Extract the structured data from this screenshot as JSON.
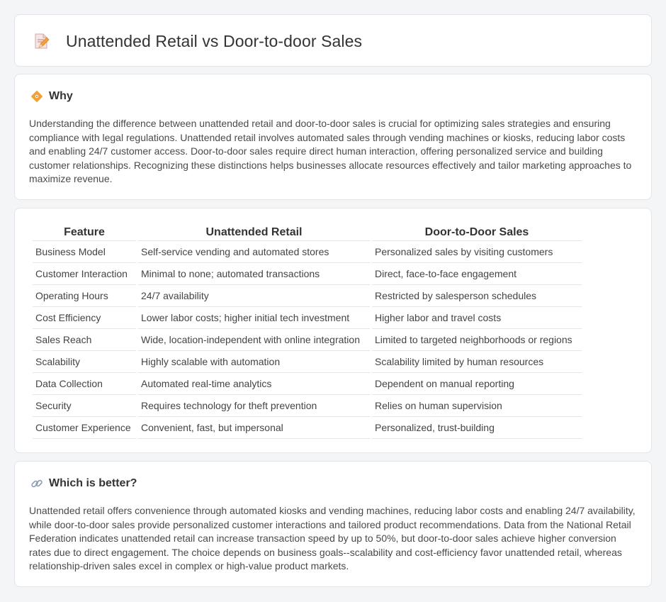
{
  "header": {
    "title": "Unattended Retail vs Door-to-door Sales",
    "icon": "document-edit-icon"
  },
  "why": {
    "title": "Why",
    "icon": "diamond-signal-icon",
    "body": "Understanding the difference between unattended retail and door-to-door sales is crucial for optimizing sales strategies and ensuring compliance with legal regulations. Unattended retail involves automated sales through vending machines or kiosks, reducing labor costs and enabling 24/7 customer access. Door-to-door sales require direct human interaction, offering personalized service and building customer relationships. Recognizing these distinctions helps businesses allocate resources effectively and tailor marketing approaches to maximize revenue."
  },
  "table": {
    "headers": [
      "Feature",
      "Unattended Retail",
      "Door-to-Door Sales"
    ],
    "rows": [
      [
        "Business Model",
        "Self-service vending and automated stores",
        "Personalized sales by visiting customers"
      ],
      [
        "Customer Interaction",
        "Minimal to none; automated transactions",
        "Direct, face-to-face engagement"
      ],
      [
        "Operating Hours",
        "24/7 availability",
        "Restricted by salesperson schedules"
      ],
      [
        "Cost Efficiency",
        "Lower labor costs; higher initial tech investment",
        "Higher labor and travel costs"
      ],
      [
        "Sales Reach",
        "Wide, location-independent with online integration",
        "Limited to targeted neighborhoods or regions"
      ],
      [
        "Scalability",
        "Highly scalable with automation",
        "Scalability limited by human resources"
      ],
      [
        "Data Collection",
        "Automated real-time analytics",
        "Dependent on manual reporting"
      ],
      [
        "Security",
        "Requires technology for theft prevention",
        "Relies on human supervision"
      ],
      [
        "Customer Experience",
        "Convenient, fast, but impersonal",
        "Personalized, trust-building"
      ]
    ]
  },
  "better": {
    "title": "Which is better?",
    "icon": "link-icon",
    "body": "Unattended retail offers convenience through automated kiosks and vending machines, reducing labor costs and enabling 24/7 availability, while door-to-door sales provide personalized customer interactions and tailored product recommendations. Data from the National Retail Federation indicates unattended retail can increase transaction speed by up to 50%, but door-to-door sales achieve higher conversion rates due to direct engagement. The choice depends on business goals--scalability and cost-efficiency favor unattended retail, whereas relationship-driven sales excel in complex or high-value product markets."
  },
  "colors": {
    "background": "#f4f5f7",
    "card": "#ffffff",
    "border": "#e2e5ea",
    "accent_orange": "#f0a23a"
  }
}
